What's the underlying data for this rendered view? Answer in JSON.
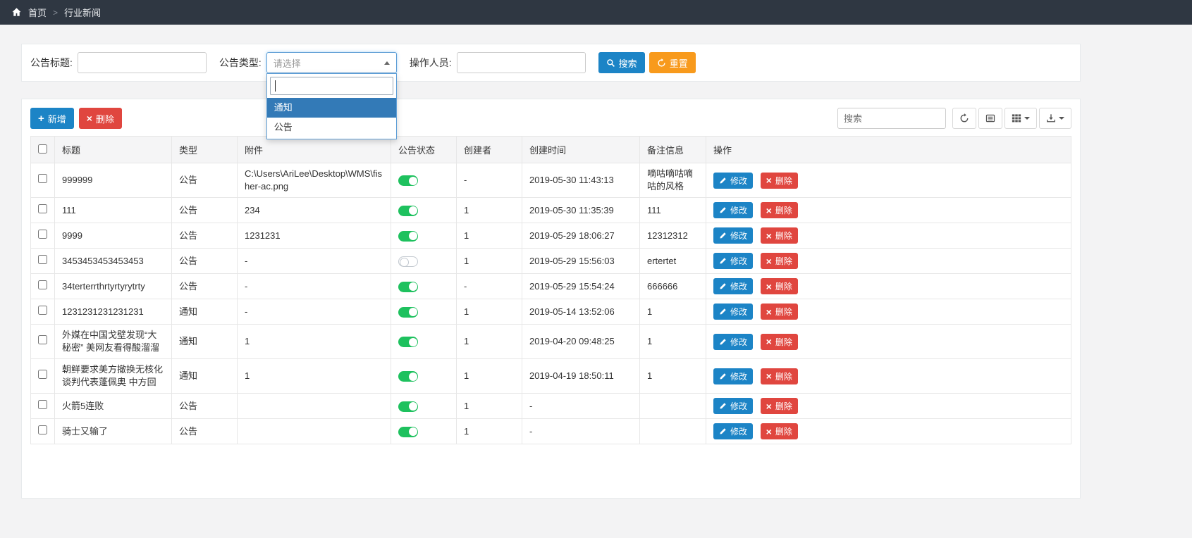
{
  "breadcrumb": {
    "home_label": "首页",
    "separator": ">",
    "current": "行业新闻"
  },
  "filters": {
    "title_label": "公告标题:",
    "title_value": "",
    "type_label": "公告类型:",
    "type_selected": "请选择",
    "operator_label": "操作人员:",
    "operator_value": "",
    "search_button": "搜索",
    "reset_button": "重置"
  },
  "type_dropdown": {
    "search_value": "",
    "highlighted": "通知",
    "options": [
      {
        "label": "通知"
      },
      {
        "label": "公告"
      }
    ]
  },
  "toolbar": {
    "add_label": "新增",
    "delete_label": "删除",
    "search_placeholder": "搜索",
    "icons": [
      "refresh-icon",
      "toggle-view-icon",
      "columns-icon",
      "export-icon"
    ]
  },
  "table": {
    "columns": {
      "title": "标题",
      "type": "类型",
      "attachment": "附件",
      "status": "公告状态",
      "creator": "创建者",
      "created": "创建时间",
      "remark": "备注信息",
      "actions": "操作"
    },
    "edit_label": "修改",
    "delete_label": "删除",
    "rows": [
      {
        "title": "999999",
        "type": "公告",
        "attachment": "C:\\Users\\AriLee\\Desktop\\WMS\\fisher-ac.png",
        "status": "on",
        "creator": "-",
        "created": "2019-05-30 11:43:13",
        "remark": "嘀咕嘀咕嘀咕的风格"
      },
      {
        "title": "111",
        "type": "公告",
        "attachment": "234",
        "status": "on",
        "creator": "1",
        "created": "2019-05-30 11:35:39",
        "remark": "111"
      },
      {
        "title": "9999",
        "type": "公告",
        "attachment": "1231231",
        "status": "on",
        "creator": "1",
        "created": "2019-05-29 18:06:27",
        "remark": "12312312"
      },
      {
        "title": "3453453453453453",
        "type": "公告",
        "attachment": "-",
        "status": "off",
        "creator": "1",
        "created": "2019-05-29 15:56:03",
        "remark": "ertertet"
      },
      {
        "title": "34terterrthrtyrtyrytrty",
        "type": "公告",
        "attachment": "-",
        "status": "on",
        "creator": "-",
        "created": "2019-05-29 15:54:24",
        "remark": "666666"
      },
      {
        "title": "1231231231231231",
        "type": "通知",
        "attachment": "-",
        "status": "on",
        "creator": "1",
        "created": "2019-05-14 13:52:06",
        "remark": "1"
      },
      {
        "title": "外媒在中国戈壁发现“大秘密” 美网友看得酸溜溜",
        "type": "通知",
        "attachment": "1",
        "status": "on",
        "creator": "1",
        "created": "2019-04-20 09:48:25",
        "remark": "1"
      },
      {
        "title": "朝鲜要求美方撤换无核化谈判代表蓬佩奥 中方回",
        "type": "通知",
        "attachment": "1",
        "status": "on",
        "creator": "1",
        "created": "2019-04-19 18:50:11",
        "remark": "1"
      },
      {
        "title": "火箭5连败",
        "type": "公告",
        "attachment": "",
        "status": "on",
        "creator": "1",
        "created": "-",
        "remark": ""
      },
      {
        "title": "骑士又输了",
        "type": "公告",
        "attachment": "",
        "status": "on",
        "creator": "1",
        "created": "-",
        "remark": ""
      }
    ]
  },
  "colors": {
    "topbar_bg": "#2f3742",
    "primary": "#1c84c6",
    "danger": "#e0463f",
    "warning": "#f89a1c",
    "success_toggle": "#1ec15e",
    "dropdown_highlight": "#337ab7"
  }
}
